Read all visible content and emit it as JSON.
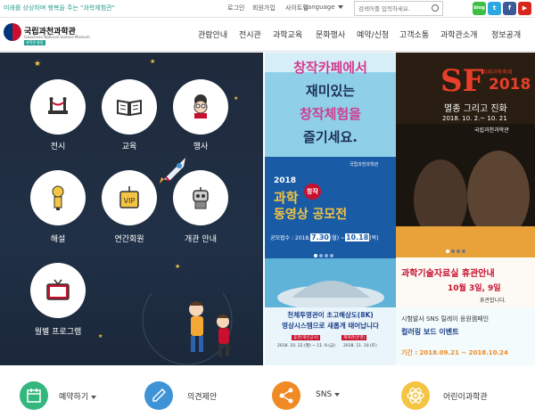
{
  "topbar": {
    "tagline": "미래를 상상하며 행복을 주는 \"과학체험관\"",
    "links": [
      "로그인",
      "회원가입",
      "사이트맵"
    ],
    "language": "Language",
    "search_placeholder": "검색어를 입력하세요.",
    "social": [
      {
        "name": "blog",
        "label": "blog",
        "color": "#3dbf45"
      },
      {
        "name": "twitter",
        "label": "t",
        "color": "#2da7e0"
      },
      {
        "name": "facebook",
        "label": "f",
        "color": "#3b5998"
      },
      {
        "name": "youtube",
        "label": "▶",
        "color": "#d9261c"
      }
    ]
  },
  "header": {
    "logo_title": "국립과천과학관",
    "logo_sub": "Gwacheon National Science Museum",
    "logo_badge": "과학관 통합",
    "nav": [
      "관람안내",
      "전시관",
      "과학교육",
      "문화행사",
      "예약/신청",
      "고객소통",
      "과학관소개",
      "정보공개"
    ]
  },
  "hero": {
    "items": [
      {
        "label": "전시",
        "icon": "exhibit-icon"
      },
      {
        "label": "교육",
        "icon": "book-icon"
      },
      {
        "label": "행사",
        "icon": "scientist-icon"
      },
      {
        "label": "해설",
        "icon": "guide-icon"
      },
      {
        "label": "연간회원",
        "icon": "vip-icon"
      },
      {
        "label": "개관 안내",
        "icon": "robot-icon"
      },
      {
        "label": "월별 프로그램",
        "icon": "tv-icon"
      }
    ]
  },
  "banners": {
    "cafe": {
      "line1": "창작카페에서",
      "line2": "재미있는",
      "line3": "창작체험을",
      "line4": "즐기세요."
    },
    "contest": {
      "year": "2018",
      "title1": "과학",
      "tag": "창작",
      "title2": "동영상 공모전",
      "period_label": "공모접수 : 2018.",
      "date1": "7.30",
      "date_sep": "(월) ~",
      "date2": "10.18",
      "date_end": "(목)",
      "org": "국립과천과학관"
    },
    "planetarium": {
      "line1": "천체투영관이 초고해상도(8K)",
      "line2": "영상시스템으로 새롭게 태어납니다",
      "note1": "휴관(개선공사)",
      "note2": "재개관(운영)",
      "date1": "2018. 10. 22.(월) ~ 11. 9.(금)",
      "date2": "2018. 11. 10.(토)"
    },
    "sf": {
      "title": "SF",
      "year": "2018",
      "sub_small": "미래과학축제",
      "theme": "멸종 그리고 진화",
      "dates": "2018. 10. 2.~ 10. 21",
      "org": "국립과천과학관"
    },
    "archive": {
      "title": "과학기술자료실 휴관안내",
      "dates": "10월 3일, 9일",
      "note": "휴관합니다."
    },
    "sns_event": {
      "line1": "시험발사 SNS 릴레이 응원캠페인",
      "line2": "컬러링 보드 이벤트",
      "period_label": "기간 : 2018.09.21",
      "period_sep": " ~ ",
      "period_end": "2018.10.24"
    }
  },
  "quick": [
    {
      "label": "예약하기",
      "icon": "calendar-icon",
      "color": "#34b77d",
      "dropdown": true
    },
    {
      "label": "의견제안",
      "icon": "pencil-icon",
      "color": "#3e93d6",
      "dropdown": false
    },
    {
      "label": "SNS",
      "icon": "share-icon",
      "color": "#f08a24",
      "dropdown": true
    },
    {
      "label": "어린이과학관",
      "icon": "atom-icon",
      "color": "#f4c542",
      "dropdown": false
    }
  ]
}
